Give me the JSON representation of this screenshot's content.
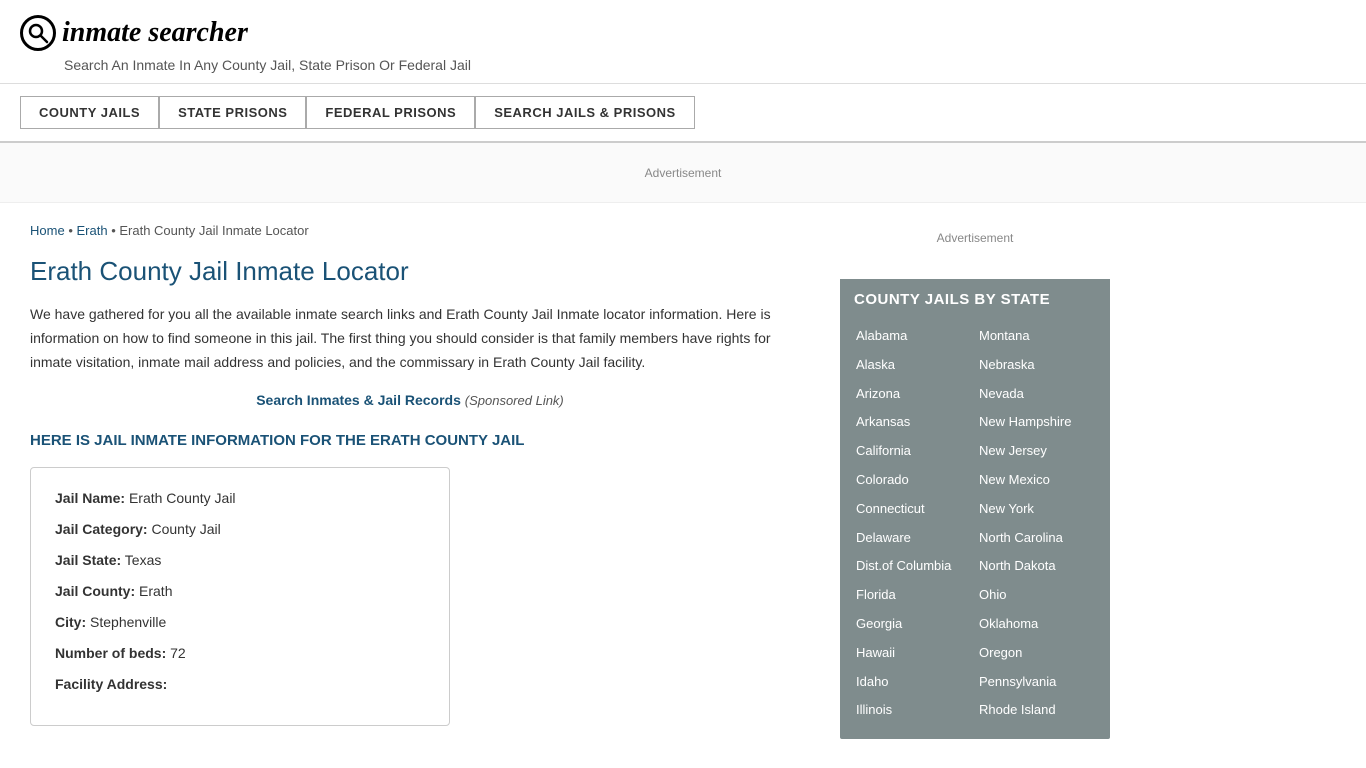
{
  "header": {
    "logo_icon": "🔍",
    "logo_text": "inmate searcher",
    "tagline": "Search An Inmate In Any County Jail, State Prison Or Federal Jail"
  },
  "nav": {
    "buttons": [
      {
        "label": "COUNTY JAILS",
        "id": "county-jails"
      },
      {
        "label": "STATE PRISONS",
        "id": "state-prisons"
      },
      {
        "label": "FEDERAL PRISONS",
        "id": "federal-prisons"
      },
      {
        "label": "SEARCH JAILS & PRISONS",
        "id": "search-jails"
      }
    ]
  },
  "ad": {
    "label": "Advertisement"
  },
  "breadcrumb": {
    "home": "Home",
    "separator1": " • ",
    "erath": "Erath",
    "separator2": " • ",
    "current": "Erath County Jail Inmate Locator"
  },
  "page_title": "Erath County Jail Inmate Locator",
  "description": "We have gathered for you all the available inmate search links and Erath County Jail Inmate locator information. Here is information on how to find someone in this jail. The first thing you should consider is that family members have rights for inmate visitation, inmate mail address and policies, and the commissary in Erath County Jail facility.",
  "sponsored": {
    "link_text": "Search Inmates & Jail Records",
    "label": "(Sponsored Link)"
  },
  "sub_heading": "HERE IS JAIL INMATE INFORMATION FOR THE ERATH COUNTY JAIL",
  "info_box": {
    "fields": [
      {
        "label": "Jail Name:",
        "value": "Erath County Jail"
      },
      {
        "label": "Jail Category:",
        "value": "County Jail"
      },
      {
        "label": "Jail State:",
        "value": "Texas"
      },
      {
        "label": "Jail County:",
        "value": "Erath"
      },
      {
        "label": "City:",
        "value": "Stephenville"
      },
      {
        "label": "Number of beds:",
        "value": "72"
      },
      {
        "label": "Facility Address:",
        "value": ""
      }
    ]
  },
  "sidebar": {
    "ad_label": "Advertisement",
    "state_box_title": "COUNTY JAILS BY STATE",
    "states_left": [
      "Alabama",
      "Alaska",
      "Arizona",
      "Arkansas",
      "California",
      "Colorado",
      "Connecticut",
      "Delaware",
      "Dist.of Columbia",
      "Florida",
      "Georgia",
      "Hawaii",
      "Idaho",
      "Illinois"
    ],
    "states_right": [
      "Montana",
      "Nebraska",
      "Nevada",
      "New Hampshire",
      "New Jersey",
      "New Mexico",
      "New York",
      "North Carolina",
      "North Dakota",
      "Ohio",
      "Oklahoma",
      "Oregon",
      "Pennsylvania",
      "Rhode Island"
    ]
  }
}
